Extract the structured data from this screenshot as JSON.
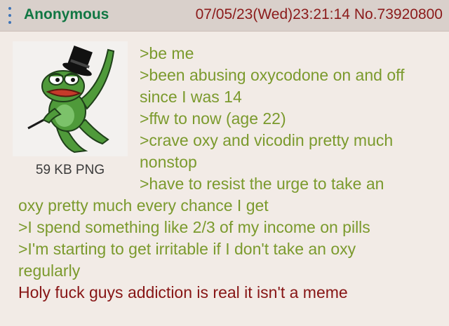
{
  "post": {
    "name": "Anonymous",
    "datetime": "07/05/23(Wed)23:21:14",
    "number": "No.73920800",
    "file_info": "59 KB PNG",
    "lines": [
      ">be me",
      ">been abusing oxycodone on and off",
      "since I was 14",
      ">ffw to now (age 22)",
      ">crave oxy and vicodin pretty much",
      "nonstop",
      ">have to resist the urge to take an",
      "oxy pretty much every chance I get",
      ">I spend something like 2/3 of my income on pills",
      ">I'm starting to get irritable if I don't take an oxy",
      "regularly",
      "Holy fuck guys addiction is real it isn't a meme"
    ]
  },
  "colors": {
    "name": "#117743",
    "meta": "#8b1a1a",
    "greentext": "#7b9a2d",
    "plaintext": "#871515",
    "body_bg": "#f2ebe6",
    "header_bg": "#d9d0cb"
  },
  "icons": {
    "menu": "vertical-dots-icon",
    "thumbnail": "frog-with-top-hat-image"
  }
}
